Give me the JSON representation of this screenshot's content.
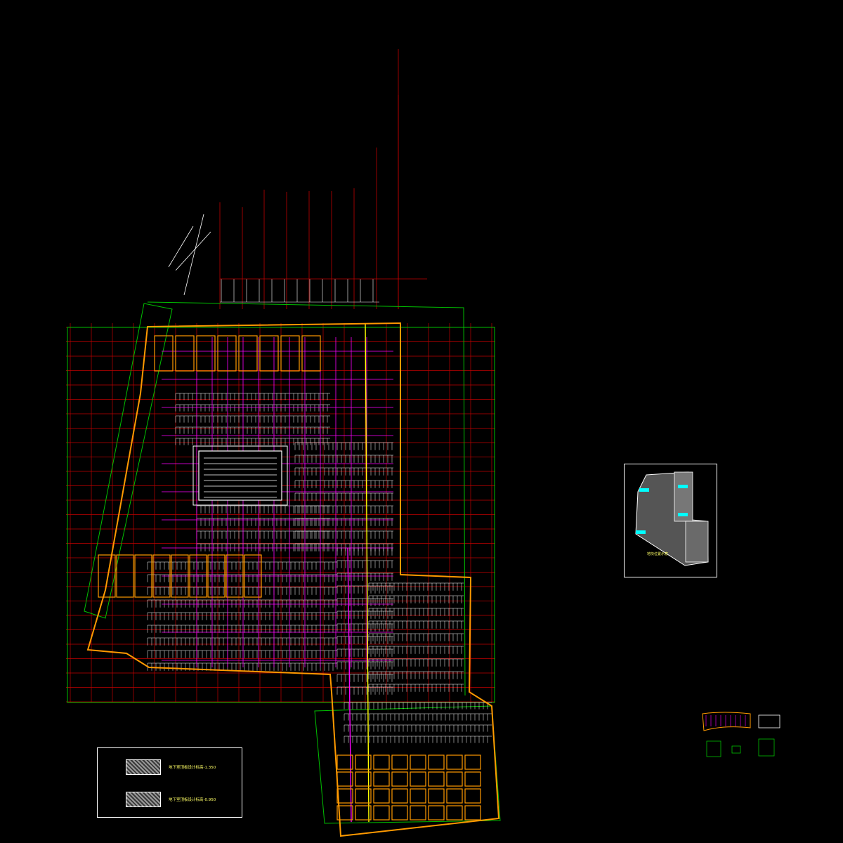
{
  "legend": {
    "rows": [
      {
        "label": "地下室顶板设计标高-1.350"
      },
      {
        "label": "地下室顶板设计标高-0.950"
      }
    ]
  },
  "keyplan": {
    "caption": "地块位置示意"
  },
  "colors": {
    "background": "#000000",
    "axis_grid": "#c00000",
    "frame": "#00c000",
    "walls": "#ff9900",
    "pipes_magenta": "#ff00ff",
    "pipes_white": "#ffffff",
    "notes_yellow": "#ffff00",
    "cyan_tags": "#00ffff"
  }
}
